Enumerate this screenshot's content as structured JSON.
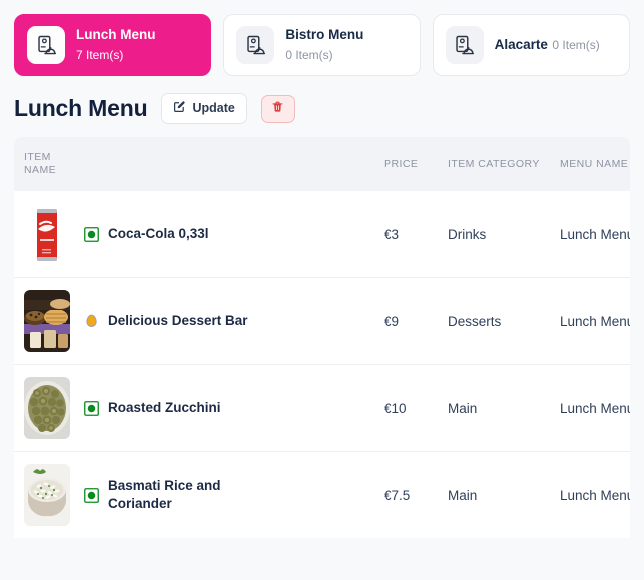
{
  "menu_cards": [
    {
      "title": "Lunch Menu",
      "count_label": "7 Item(s)",
      "icon": "menu-cloche-icon",
      "active": true
    },
    {
      "title": "Bistro Menu",
      "count_label": "0 Item(s)",
      "icon": "menu-cloche-icon",
      "active": false
    },
    {
      "title": "Alacarte",
      "count_label": "0 Item(s)",
      "icon": "menu-cloche-icon",
      "active": false
    }
  ],
  "header": {
    "page_title": "Lunch Menu",
    "update_label": "Update",
    "update_icon": "pencil-square-icon",
    "delete_icon": "trash-icon"
  },
  "table": {
    "columns": [
      "",
      "ITEM NAME",
      "PRICE",
      "ITEM CATEGORY",
      "MENU NAME"
    ],
    "rows": [
      {
        "image": "coca-cola-can-thumbnail",
        "diet": "veg-marker",
        "name": "Coca-Cola 0,33l",
        "price": "€3",
        "category": "Drinks",
        "menu": "Lunch Menu"
      },
      {
        "image": "dessert-bar-thumbnail",
        "diet": "egg-marker",
        "name": "Delicious Dessert Bar",
        "price": "€9",
        "category": "Desserts",
        "menu": "Lunch Menu"
      },
      {
        "image": "roasted-zucchini-thumbnail",
        "diet": "veg-marker",
        "name": "Roasted Zucchini",
        "price": "€10",
        "category": "Main",
        "menu": "Lunch Menu"
      },
      {
        "image": "basmati-rice-thumbnail",
        "diet": "veg-marker",
        "name": "Basmati Rice and Coriander",
        "price": "€7.5",
        "category": "Main",
        "menu": "Lunch Menu"
      }
    ]
  },
  "colors": {
    "accent_pink": "#ed1e8c",
    "page_bg": "#f8f9fb",
    "card_bg": "#ffffff",
    "header_row_bg": "#f2f3f6",
    "title_text": "#14213d",
    "muted_text": "#8d94a4",
    "danger": "#e03b3b",
    "danger_bg": "#fdeaea",
    "veg_green": "#0b8a1f",
    "egg_yellow": "#f3a81c"
  }
}
